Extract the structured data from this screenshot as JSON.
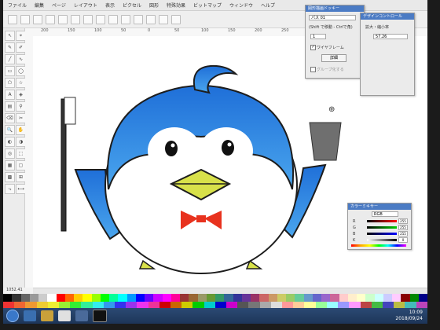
{
  "menubar": {
    "items": [
      "ファイル",
      "編集",
      "ページ",
      "レイアウト",
      "表示",
      "ピクセル",
      "図形",
      "特殊効果",
      "ビットマップ",
      "ウィンドウ",
      "ヘルプ"
    ]
  },
  "ruler": {
    "ticks": [
      "200",
      "150",
      "100",
      "50",
      "0",
      "50",
      "100",
      "150",
      "200",
      "250",
      "300",
      "350",
      "400",
      "450",
      "500"
    ]
  },
  "panels": {
    "shape": {
      "title": "図形描画ドッキー",
      "field1": "パス 01",
      "label1": "(Shift で移動 - Ctrlで角)",
      "spin_value": "1",
      "wireframe_checked": true,
      "wireframe_label": "ワイヤフレーム",
      "detail_button": "詳細",
      "disabled_label": "グループ化する"
    },
    "design": {
      "title": "デザインコントロール",
      "label": "拡大・縮小率",
      "value": "57.26"
    },
    "color_mixer": {
      "title": "カラーミキサー",
      "select": "RGB",
      "channels": [
        {
          "label": "R",
          "value": "255"
        },
        {
          "label": "G",
          "value": "255"
        },
        {
          "label": "B",
          "value": "255"
        },
        {
          "label": "K",
          "value": "0"
        }
      ]
    }
  },
  "status": {
    "coords": "1052.41"
  },
  "taskbar": {
    "time": "10:09",
    "date": "2018/09/24"
  },
  "colors": {
    "penguin_blue": "#2b7fe0",
    "beak_yellow": "#d8e14a",
    "bowtie_red": "#e8321e",
    "cup_gray": "#6f6f6f",
    "outline": "#1d1d1d"
  }
}
